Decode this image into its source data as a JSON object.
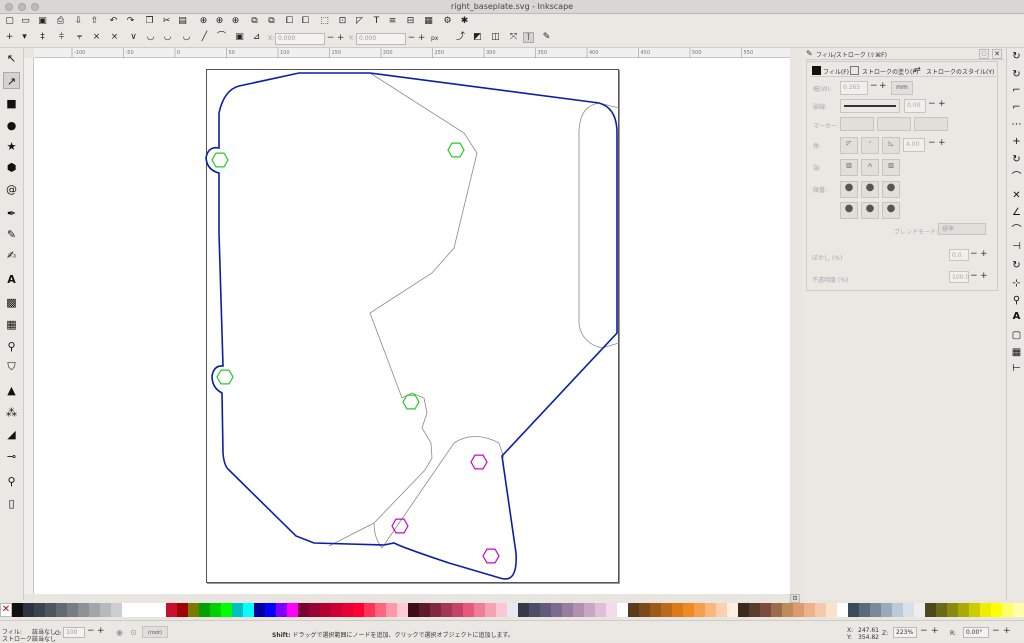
{
  "window": {
    "title": "right_baseplate.svg - Inkscape"
  },
  "controls": {
    "x_label": "X:",
    "x_value": "0.000",
    "y_label": "Y:",
    "y_value": "0.000",
    "unit": "px",
    "spin_minus": "−",
    "spin_plus": "+"
  },
  "rulers": {
    "top": [
      "-100",
      "-50",
      "0",
      "50",
      "100",
      "150",
      "200",
      "250",
      "300",
      "350",
      "400",
      "450",
      "500",
      "550"
    ]
  },
  "panel": {
    "title": "フィル/ストローク (⇧⌘F)",
    "tabs": [
      "フィル(F)",
      "ストロークの塗り(P)",
      "ストロークのスタイル(Y)"
    ],
    "width_label": "幅(W):",
    "width_value": "0.265",
    "width_unit": "mm",
    "dash_label": "破線:",
    "dash_offset": "0.00",
    "markers_label": "マーカー:",
    "corner_label": "角:",
    "miter_value": "4.00",
    "cap_label": "端:",
    "order_label": "順番:",
    "blend_label": "ブレンドモード:",
    "blend_value": "標準",
    "blur_label": "ぼかし (%)",
    "blur_value": "0.0",
    "opacity_label": "不透明度 (%)",
    "opacity_value": "100.0"
  },
  "palette": {
    "colors": [
      "#111111",
      "#2b3440",
      "#3a4450",
      "#4d5660",
      "#62696f",
      "#777d82",
      "#8c9196",
      "#a2a6aa",
      "#b7babd",
      "#cccfd1",
      "#ffffff",
      "#ffffff",
      "#ffffff",
      "#ffffff",
      "#c8102e",
      "#a00000",
      "#7a7a00",
      "#00a000",
      "#00d000",
      "#00ff00",
      "#00c0c0",
      "#00ffff",
      "#0000a0",
      "#0000ff",
      "#8000ff",
      "#ff00ff",
      "#7a0033",
      "#990033",
      "#b30033",
      "#cc0033",
      "#e60033",
      "#ff0033",
      "#ff3355",
      "#ff6680",
      "#ff99aa",
      "#ffccd5",
      "#3d0d1a",
      "#5e1a2b",
      "#802840",
      "#a33653",
      "#c54466",
      "#e55a7a",
      "#f07d96",
      "#f5a3b4",
      "#fac8d2",
      "#e8e8f0",
      "#34384a",
      "#4a4f66",
      "#625a7a",
      "#7c6b8c",
      "#977d9e",
      "#b190b0",
      "#c9a6c4",
      "#dfbfd9",
      "#f0dcec",
      "#ffffff",
      "#5a3a1a",
      "#7a4a1a",
      "#9a5a1a",
      "#ba6a1a",
      "#da7a1a",
      "#f08a20",
      "#f4a050",
      "#f8b880",
      "#fcd0b0",
      "#fff0e0",
      "#3b2b1b",
      "#5b3b2b",
      "#7b4b3b",
      "#9b6b4b",
      "#bb8b5b",
      "#db9b6b",
      "#ebb38b",
      "#f3cbab",
      "#fbe3cb",
      "#ffffff",
      "#3a4a5a",
      "#5a6a7a",
      "#7a8a9a",
      "#9aaaba",
      "#bacada",
      "#dae0ea",
      "#eeeeee",
      "#4a4a1a",
      "#6a6a1a",
      "#8a8a10",
      "#aaaa00",
      "#cccc00",
      "#eeee00",
      "#ffff00",
      "#ffff66",
      "#ffffaa"
    ]
  },
  "status": {
    "fill_label": "フィル:",
    "stroke_label": "ストローク:",
    "fill_value": "該当なし",
    "stroke_value": "該当なし",
    "opacity_label": "O:",
    "opacity_value": "100",
    "layer": "(root)",
    "message_bold": "Shift:",
    "message": " ドラッグで選択範囲にノードを追加、クリックで選択オブジェクトに追加します。",
    "x_label": "X:",
    "y_label": "Y:",
    "cursor_x": "247.61",
    "cursor_y": "354.82",
    "zoom_label": "Z:",
    "zoom": "223%",
    "rotate_label": "R:",
    "rotation": "0.00°"
  },
  "drawing": {
    "outline_color": "#0a1fa8",
    "inner_line_color": "#8a8a8a",
    "green_hex_color": "#22cc22",
    "magenta_hex_color": "#cc00cc"
  }
}
